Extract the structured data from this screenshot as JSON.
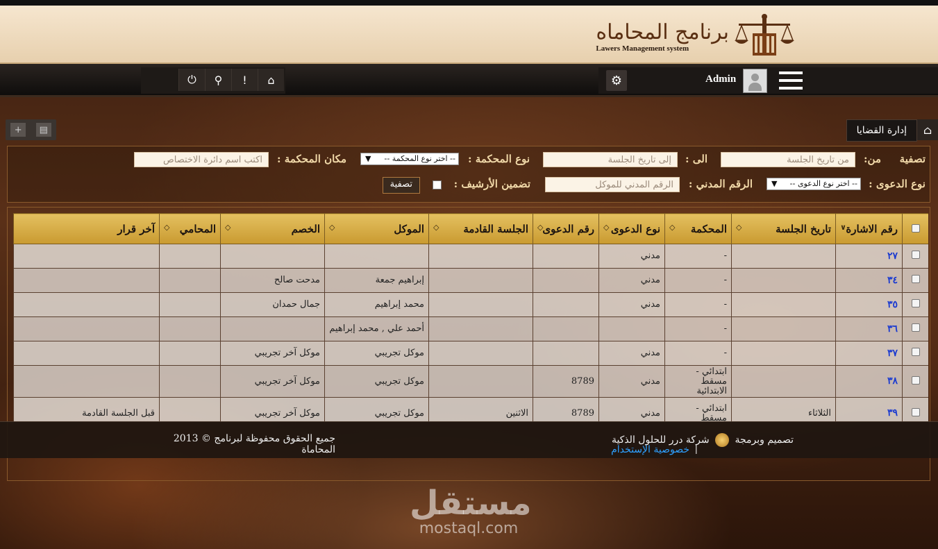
{
  "app": {
    "logo_ar": "برنامج المحاماه",
    "logo_en": "Lawers Management system"
  },
  "nav": {
    "user_name": "Admin",
    "icons": [
      "power-icon",
      "search-icon",
      "info-icon",
      "home-icon",
      "gear-icon",
      "menu-icon"
    ]
  },
  "breadcrumb": {
    "current": "إدارة القضايا"
  },
  "filters": {
    "filter_label": "تصفية",
    "from_label": "من:",
    "from_placeholder": "من تاريخ الجلسة",
    "to_label": "الى :",
    "to_placeholder": "إلى تاريخ الجلسة",
    "court_type_label": "نوع المحكمة :",
    "court_type_select": "-- اختر نوع المحكمة --",
    "court_place_label": "مكان المحكمة :",
    "court_place_placeholder": "اكتب اسم دائرة الاختصاص",
    "case_type_label": "نوع الدعوى :",
    "case_type_select": "-- اختر نوع الدعوى --",
    "civil_id_label": "الرقم المدني :",
    "civil_id_placeholder": "الرقم المدني للموكل",
    "archive_label": "تضمين الأرشيف :",
    "filter_button": "تصفية"
  },
  "table": {
    "columns": [
      "رقم الاشارة",
      "تاريخ الجلسة",
      "المحكمة",
      "نوع الدعوى",
      "رقم الدعوى",
      "الجلسة القادمة",
      "الموكل",
      "الخصم",
      "المحامي",
      "آخر قرار"
    ],
    "rows": [
      {
        "ref": "٢٧",
        "session_date": "",
        "court": "-",
        "case_type": "مدني",
        "case_no": "",
        "next_session": "",
        "client": "",
        "opponent": "",
        "lawyer": "",
        "last_decision": ""
      },
      {
        "ref": "٣٤",
        "session_date": "",
        "court": "-",
        "case_type": "مدني",
        "case_no": "",
        "next_session": "",
        "client": "إبراهيم جمعة",
        "opponent": "مدحت صالح",
        "lawyer": "",
        "last_decision": ""
      },
      {
        "ref": "٣٥",
        "session_date": "",
        "court": "-",
        "case_type": "مدني",
        "case_no": "",
        "next_session": "",
        "client": "محمد إبراهيم",
        "opponent": "جمال حمدان",
        "lawyer": "",
        "last_decision": ""
      },
      {
        "ref": "٣٦",
        "session_date": "",
        "court": "-",
        "case_type": "",
        "case_no": "",
        "next_session": "",
        "client": "أحمد علي , محمد إبراهيم",
        "opponent": "",
        "lawyer": "",
        "last_decision": ""
      },
      {
        "ref": "٣٧",
        "session_date": "",
        "court": "-",
        "case_type": "مدني",
        "case_no": "",
        "next_session": "",
        "client": "موكل تجريبي",
        "opponent": "موكل آخر تجريبي",
        "lawyer": "",
        "last_decision": ""
      },
      {
        "ref": "٣٨",
        "session_date": "",
        "court": "ابتدائي - مسقط الابتدائية",
        "case_type": "مدني",
        "case_no": "8789",
        "next_session": "",
        "client": "موكل تجريبي",
        "opponent": "موكل آخر تجريبي",
        "lawyer": "",
        "last_decision": ""
      },
      {
        "ref": "٣٩",
        "session_date": "الثلاثاء",
        "court": "ابتدائي - مسقط",
        "case_type": "مدني",
        "case_no": "8789",
        "next_session": "الاثنين",
        "client": "موكل تجريبي",
        "opponent": "موكل آخر تجريبي",
        "lawyer": "",
        "last_decision": "قبل الجلسة القادمة"
      }
    ]
  },
  "footer": {
    "design_text": "تصميم وبرمجة",
    "company": "شركة درر للحلول الذكية",
    "privacy_link": "خصوصية الإستخدام",
    "separator": "|",
    "copyright": "جميع الحقوق محفوظة لبرنامج © 2013 المحاماة"
  },
  "watermark": {
    "ar": "مستقل",
    "en": "mostaql.com"
  }
}
